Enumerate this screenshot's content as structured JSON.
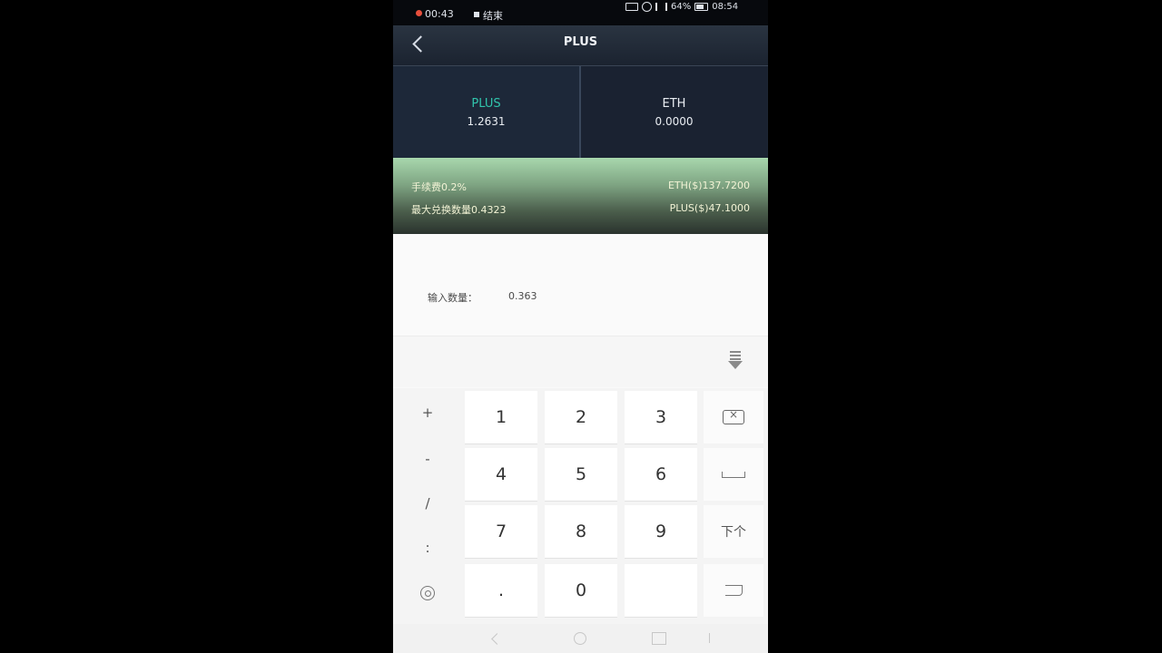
{
  "status_bar": {
    "rec_time": "00:43",
    "rec_label": "结束",
    "battery": "64%",
    "clock": "08:54"
  },
  "header": {
    "title": "PLUS"
  },
  "tabs": [
    {
      "name": "PLUS",
      "value": "1.2631",
      "color": "#31c5ad"
    },
    {
      "name": "ETH",
      "value": "0.0000"
    }
  ],
  "banner": {
    "fee": "手续费0.2%",
    "max_quantity": "最大兑换数量0.4323",
    "eth_price": "ETH($)137.7200",
    "plus_price": "PLUS($)47.1000"
  },
  "input": {
    "label": "输入数量：",
    "value": "0.363"
  },
  "keyboard": {
    "symbols": [
      "+",
      "-",
      "/",
      ":"
    ],
    "rows": [
      [
        "1",
        "2",
        "3"
      ],
      [
        "4",
        "5",
        "6"
      ],
      [
        "7",
        "8",
        "9"
      ],
      [
        ".",
        "0",
        ""
      ]
    ],
    "next_label": "下个"
  },
  "icons": {
    "back": "chevron-left-icon",
    "hide_keyboard": "keyboard-hide-icon",
    "backspace": "backspace-icon",
    "space": "space-icon",
    "enter": "enter-icon",
    "at": "at-icon"
  }
}
